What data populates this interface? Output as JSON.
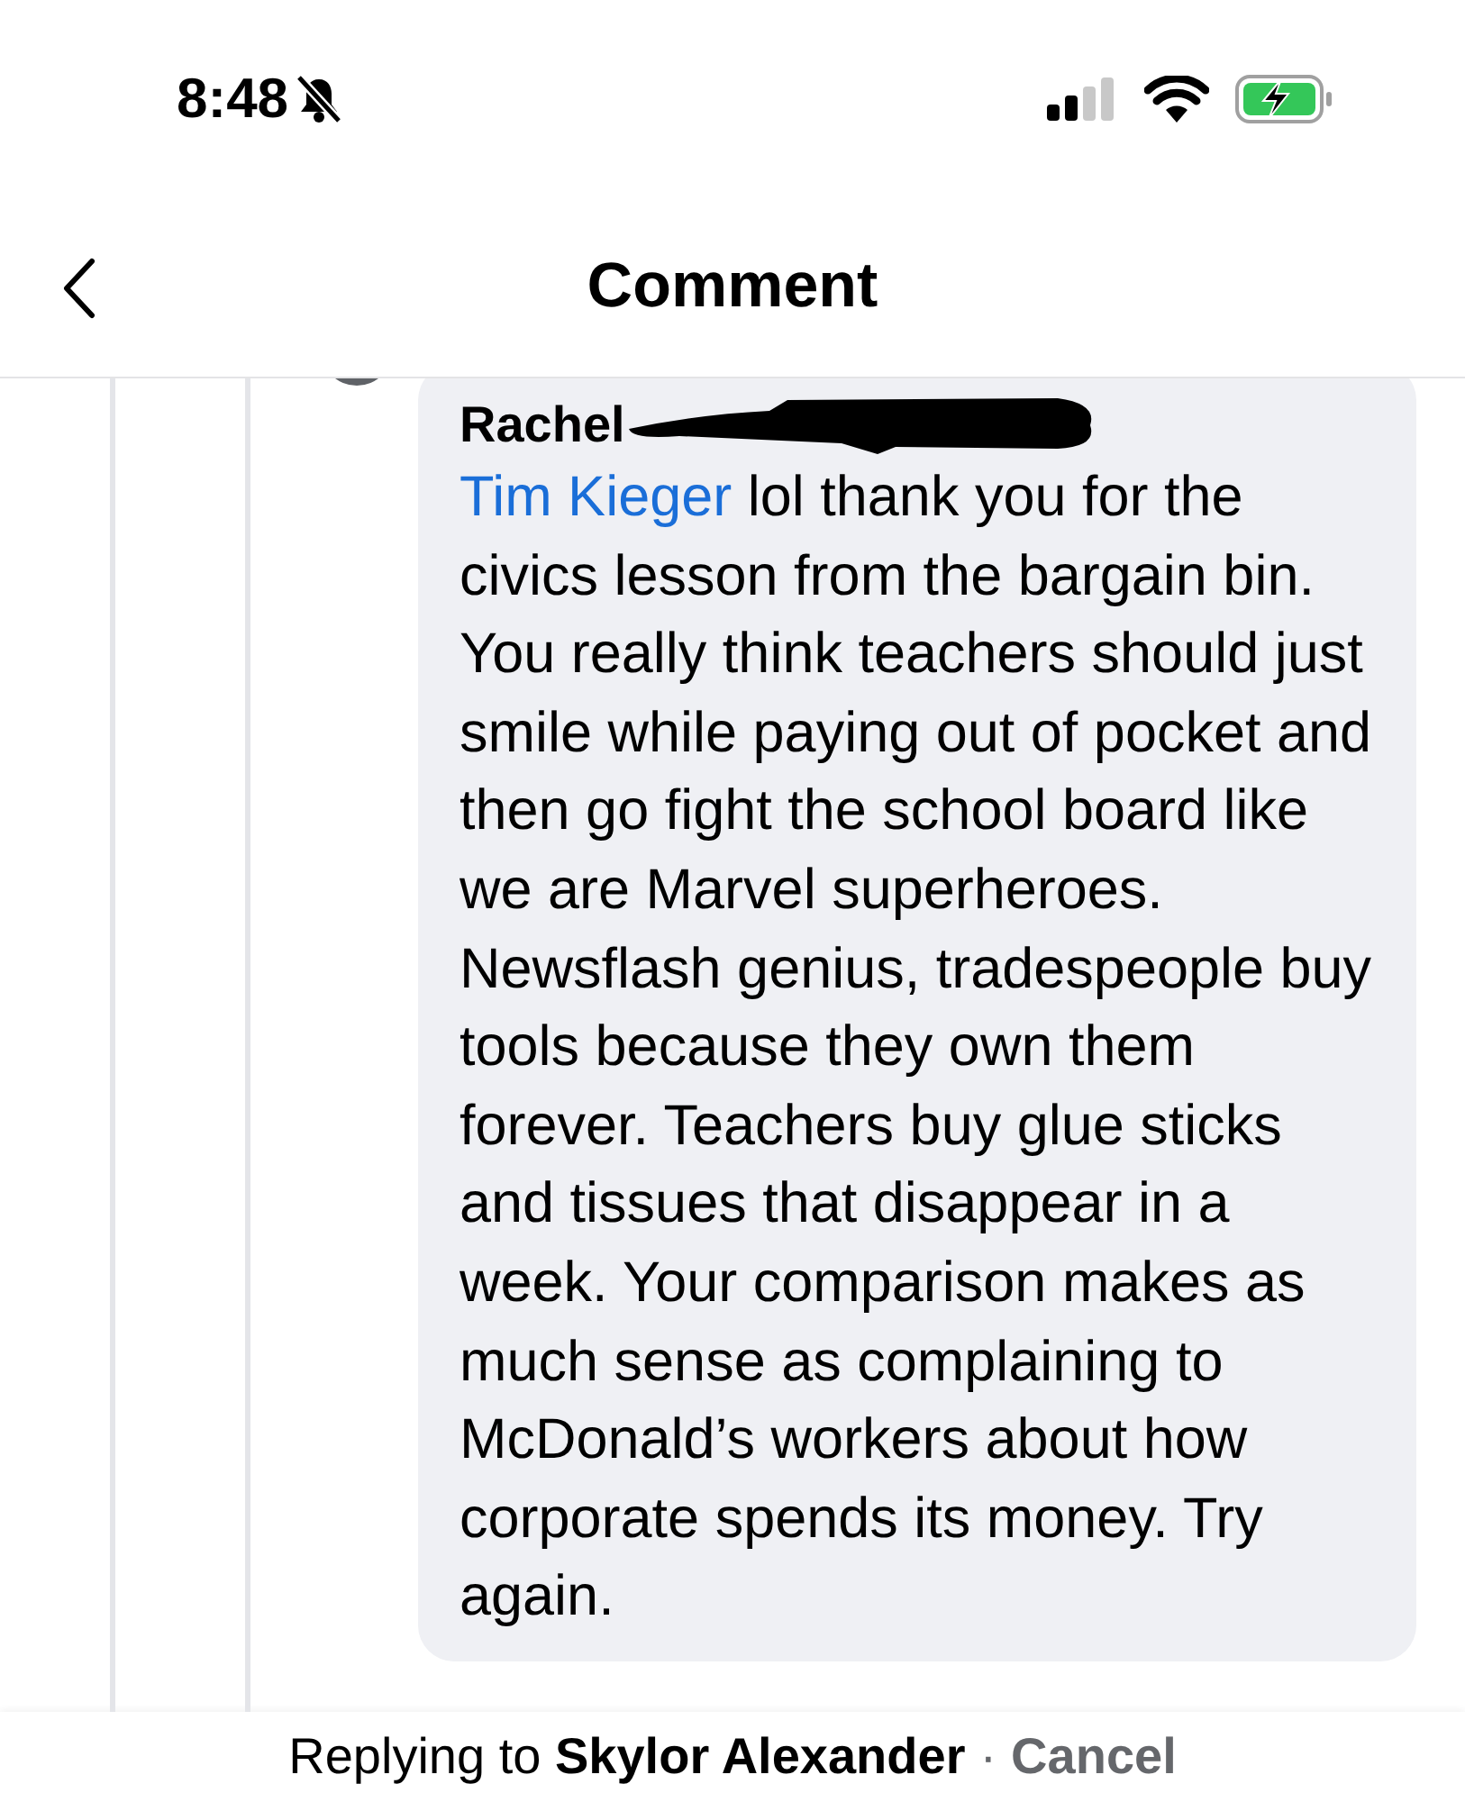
{
  "status_bar": {
    "time": "8:48",
    "silent": true,
    "charging": true
  },
  "header": {
    "title": "Comment"
  },
  "comment": {
    "author": "Rachel",
    "author_redacted": true,
    "mention": "Tim Kieger",
    "text": "lol thank you for the civics lesson from the bargain bin. You really think teachers should just smile while paying out of pocket and then go fight the school board like we are Marvel superheroes. Newsflash genius, tradespeople buy tools because they own them forever. Teachers buy glue sticks and tissues that disappear in a week. Your comparison makes as much sense as complaining to McDonald’s workers about how corporate spends its money. Try again."
  },
  "reply_bar": {
    "label": "Replying to **Skylor Alexander**",
    "separator": "·",
    "cancel": "Cancel"
  }
}
